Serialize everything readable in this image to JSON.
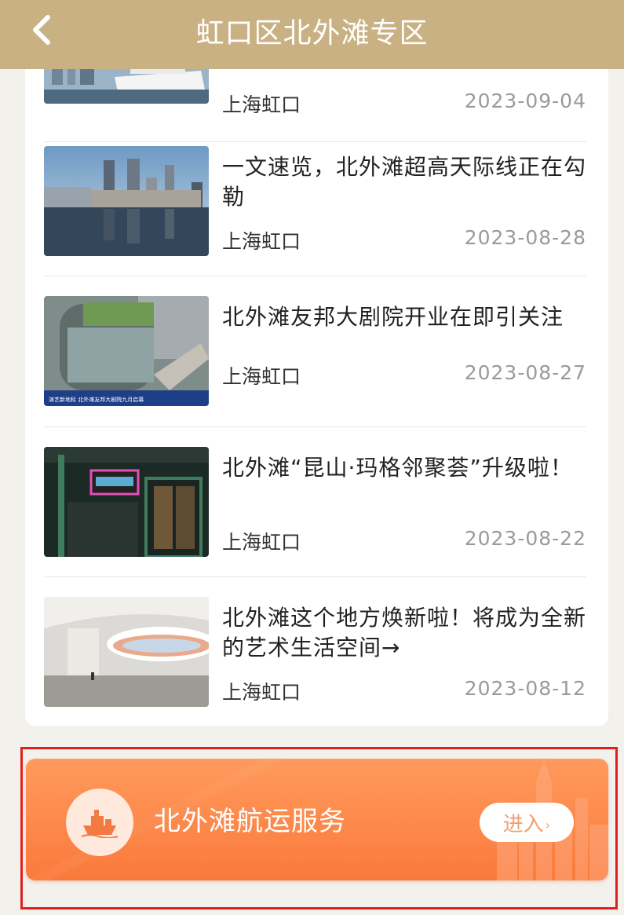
{
  "header": {
    "title": "虹口区北外滩专区",
    "back_icon": "chevron-left-icon",
    "background_color": "#c9b184"
  },
  "news": [
    {
      "title": "",
      "source": "上海虹口",
      "date": "2023-09-04",
      "image": "cruise-ship-harbor"
    },
    {
      "title": "一文速览，北外滩超高天际线正在勾勒",
      "source": "上海虹口",
      "date": "2023-08-28",
      "image": "skyline-reflection"
    },
    {
      "title": "北外滩友邦大剧院开业在即引关注",
      "source": "上海虹口",
      "date": "2023-08-27",
      "image": "theater-aerial",
      "image_caption": "演艺新地标 北外滩友邦大剧院九月启幕"
    },
    {
      "title": "北外滩“昆山·玛格邻聚荟”升级啦！",
      "source": "上海虹口",
      "date": "2023-08-22",
      "image": "neon-storefront"
    },
    {
      "title": "北外滩这个地方焕新啦！将成为全新的艺术生活空间→",
      "source": "上海虹口",
      "date": "2023-08-12",
      "image": "art-space-rendering"
    }
  ],
  "banner": {
    "title": "北外滩航运服务",
    "enter_label": "进入",
    "enter_chevron": "›",
    "icon": "ship-icon",
    "accent_color": "#fa7a3c"
  }
}
